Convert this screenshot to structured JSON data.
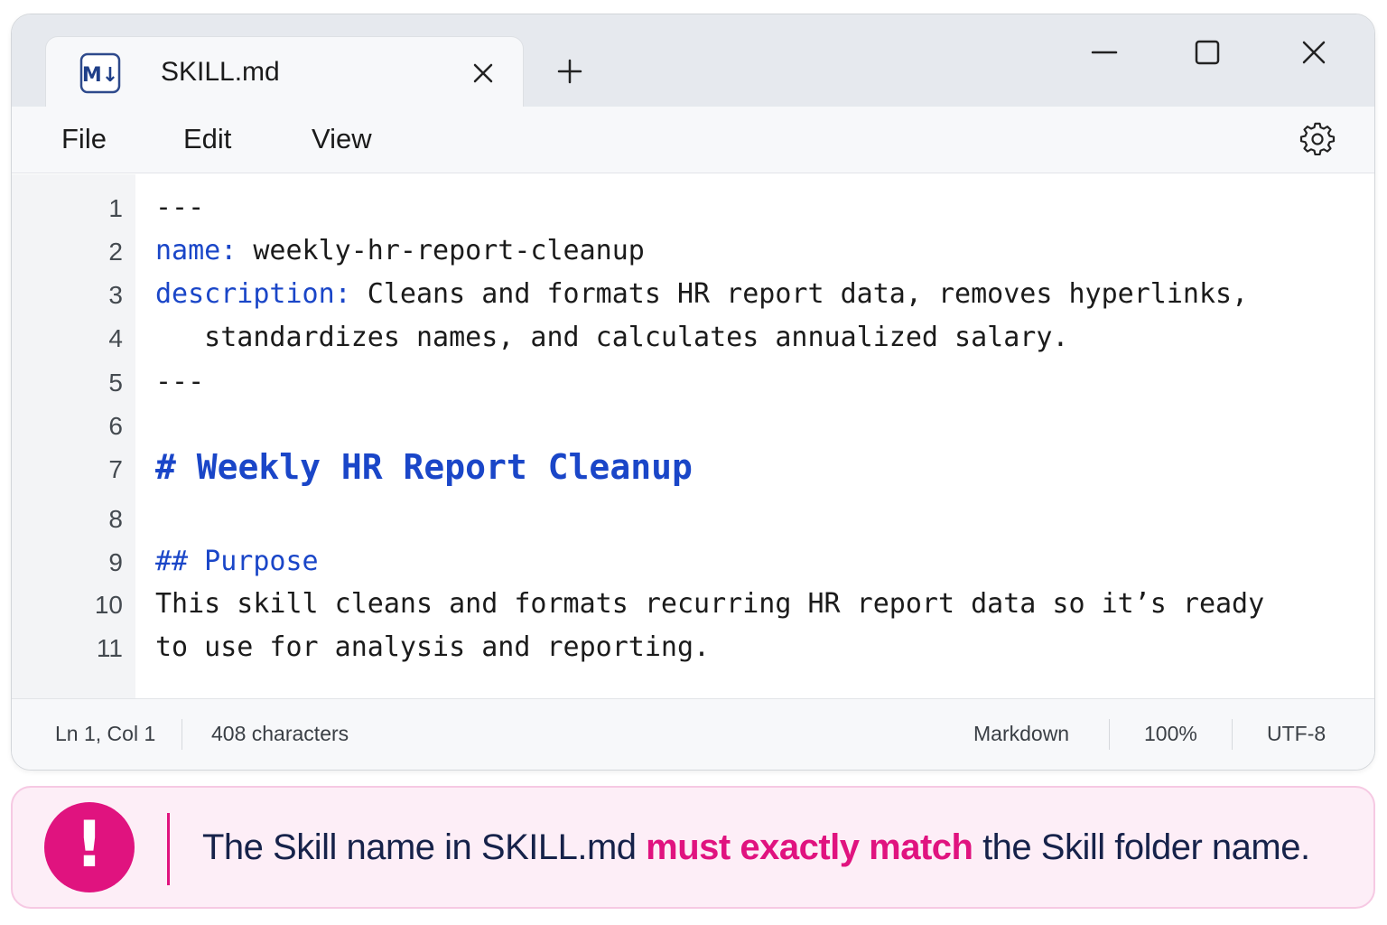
{
  "window": {
    "tab": {
      "icon": "markdown-file-icon",
      "title": "SKILL.md"
    },
    "controls": [
      "close-tab-icon",
      "new-tab-icon",
      "minimize-icon",
      "maximize-icon",
      "close-window-icon"
    ]
  },
  "menu": {
    "file": "File",
    "edit": "Edit",
    "view": "View",
    "settings_icon": "gear-icon"
  },
  "editor": {
    "line_numbers": [
      "1",
      "2",
      "3",
      "4",
      "5",
      "6",
      "7",
      "8",
      "9",
      "10",
      "11"
    ],
    "lines": {
      "l1": "---",
      "l2_key": "name:",
      "l2_val": " weekly-hr-report-cleanup",
      "l3_key": "description:",
      "l3_val": " Cleans and formats HR report data, removes hyperlinks,",
      "l4": "   standardizes names, and calculates annualized salary.",
      "l5": "---",
      "l7": "# Weekly HR Report Cleanup",
      "l9": "## Purpose",
      "l10": "This skill cleans and formats recurring HR report data so it’s ready",
      "l11": "to use for analysis and reporting."
    },
    "colors": {
      "syntax_accent": "#1a46c8",
      "text": "#1b1b1b",
      "gutter": "#f3f4f6"
    }
  },
  "status": {
    "position": "Ln 1, Col 1",
    "characters": "408 characters",
    "language": "Markdown",
    "zoom": "100%",
    "encoding": "UTF-8"
  },
  "alert": {
    "icon": "exclamation-icon",
    "text_before": "The Skill name in SKILL.md ",
    "text_emphasis": "must exactly match",
    "text_after": " the Skill folder name.",
    "colors": {
      "accent": "#e0137f",
      "background": "#fdeef7"
    }
  }
}
